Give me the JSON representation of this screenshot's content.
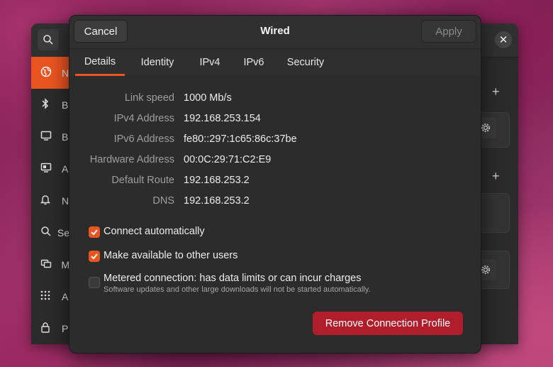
{
  "background_window": {
    "sidebar_items": [
      {
        "icon": "network-icon",
        "letter": "N"
      },
      {
        "icon": "bluetooth-icon",
        "letter": "B"
      },
      {
        "icon": "background-icon",
        "letter": "B"
      },
      {
        "icon": "appearance-icon",
        "letter": "A"
      },
      {
        "icon": "notifications-icon",
        "letter": "N"
      },
      {
        "icon": "search-icon",
        "letter": "Se"
      },
      {
        "icon": "multitasking-icon",
        "letter": "M"
      },
      {
        "icon": "applications-icon",
        "letter": "A"
      },
      {
        "icon": "privacy-icon",
        "letter": "P"
      }
    ]
  },
  "dialog": {
    "title": "Wired",
    "cancel_label": "Cancel",
    "apply_label": "Apply",
    "tabs": [
      {
        "label": "Details",
        "active": true
      },
      {
        "label": "Identity",
        "active": false
      },
      {
        "label": "IPv4",
        "active": false
      },
      {
        "label": "IPv6",
        "active": false
      },
      {
        "label": "Security",
        "active": false
      }
    ],
    "details": [
      {
        "key": "Link speed",
        "value": "1000 Mb/s"
      },
      {
        "key": "IPv4 Address",
        "value": "192.168.253.154"
      },
      {
        "key": "IPv6 Address",
        "value": "fe80::297:1c65:86c:37be"
      },
      {
        "key": "Hardware Address",
        "value": "00:0C:29:71:C2:E9"
      },
      {
        "key": "Default Route",
        "value": "192.168.253.2"
      },
      {
        "key": "DNS",
        "value": "192.168.253.2"
      }
    ],
    "connect_automatically": {
      "label": "Connect automatically",
      "checked": true
    },
    "available_to_others": {
      "label": "Make available to other users",
      "checked": true
    },
    "metered": {
      "label": "Metered connection: has data limits or can incur charges",
      "sublabel": "Software updates and other large downloads will not be started automatically.",
      "checked": false
    },
    "remove_label": "Remove Connection Profile"
  },
  "colors": {
    "accent": "#e95420",
    "destructive": "#b01e2b",
    "dialog_bg": "#2c2c2c"
  }
}
